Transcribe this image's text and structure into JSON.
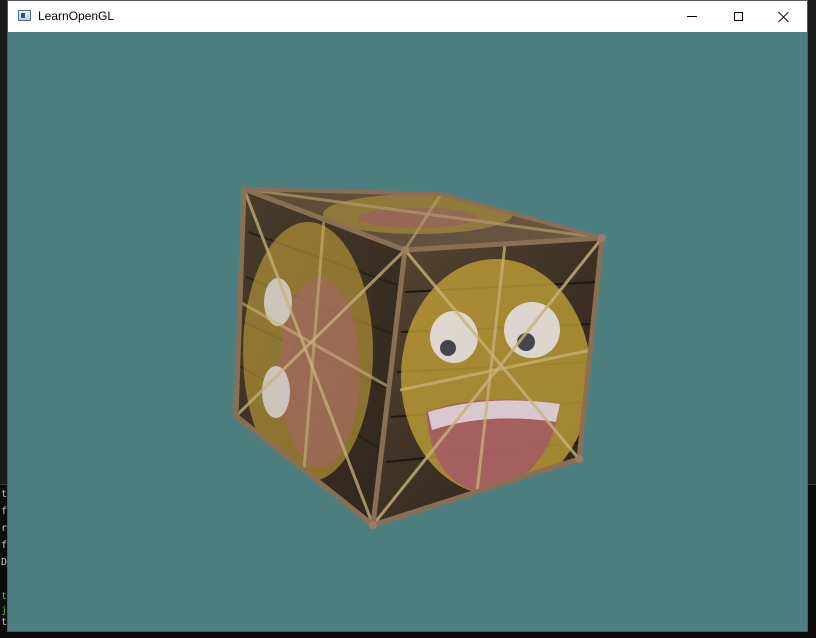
{
  "window": {
    "title": "LearnOpenGL",
    "icon": "app-window-icon",
    "controls": {
      "minimize": "minimize-icon",
      "maximize": "maximize-icon",
      "close": "close-icon"
    }
  },
  "viewport": {
    "clear_color": "#4d7f80",
    "scene": "textured-rotating-cube",
    "textures": [
      "wooden-container",
      "awesome-face"
    ]
  },
  "background_terminal": {
    "lines": [
      {
        "text": "t",
        "color": "#c8c8c8"
      },
      {
        "text": "f",
        "color": "#c8c8c8"
      },
      {
        "text": "r",
        "color": "#c8c8c8"
      },
      {
        "text": "f",
        "color": "#c8c8c8"
      },
      {
        "text": "D",
        "color": "#c8c8c8"
      },
      {
        "text": "t",
        "color": "#3fbf3f"
      },
      {
        "text": "j",
        "color": "#3fbf3f"
      },
      {
        "text": "t",
        "color": "#c8c8c8"
      }
    ]
  }
}
